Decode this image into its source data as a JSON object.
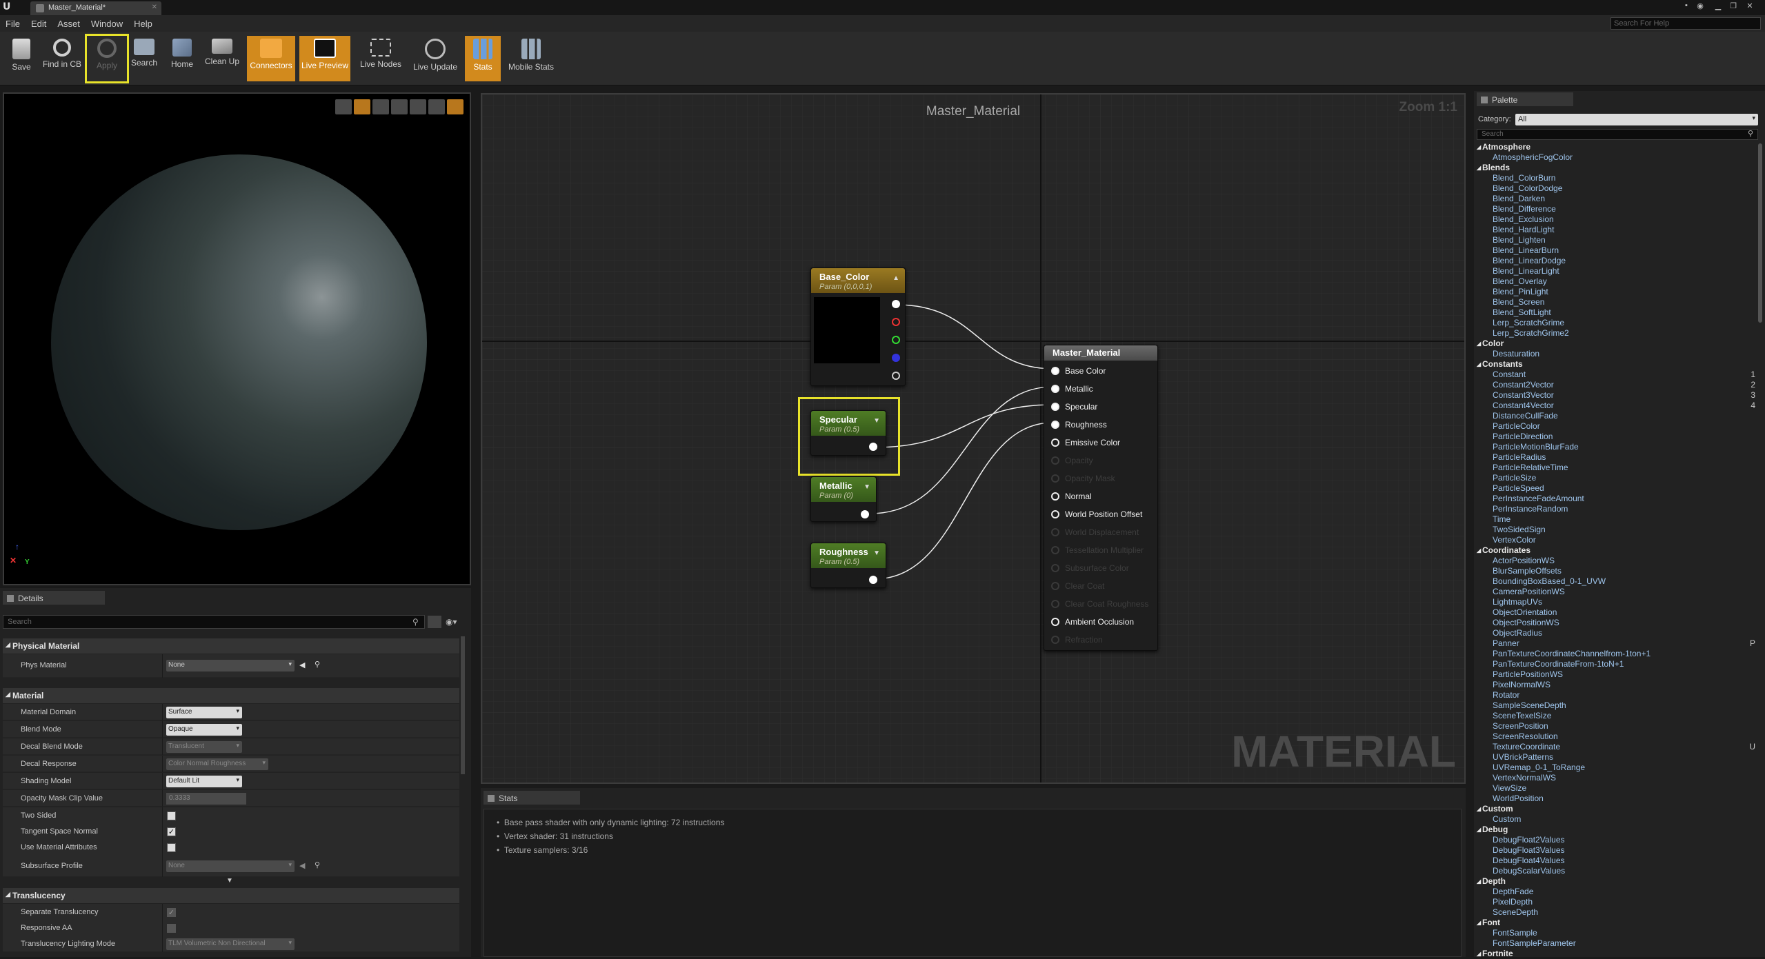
{
  "window": {
    "tab_title": "Master_Material*"
  },
  "menu": [
    "File",
    "Edit",
    "Asset",
    "Window",
    "Help"
  ],
  "help_search_placeholder": "Search For Help",
  "toolbar": [
    {
      "label": "Save",
      "state": "normal"
    },
    {
      "label": "Find in CB",
      "state": "normal"
    },
    {
      "label": "Apply",
      "state": "disabled-highlighted"
    },
    {
      "label": "Search",
      "state": "normal"
    },
    {
      "label": "Home",
      "state": "normal"
    },
    {
      "label": "Clean Up",
      "state": "normal"
    },
    {
      "label": "Connectors",
      "state": "active"
    },
    {
      "label": "Live Preview",
      "state": "active"
    },
    {
      "label": "Live Nodes",
      "state": "normal"
    },
    {
      "label": "Live Update",
      "state": "normal"
    },
    {
      "label": "Stats",
      "state": "active"
    },
    {
      "label": "Mobile Stats",
      "state": "normal"
    }
  ],
  "details": {
    "tab": "Details",
    "search_placeholder": "Search",
    "sections": {
      "physical": "Physical Material",
      "material": "Material",
      "translucency": "Translucency"
    },
    "rows": {
      "phys_material": {
        "label": "Phys Material",
        "value": "None"
      },
      "material_domain": {
        "label": "Material Domain",
        "value": "Surface"
      },
      "blend_mode": {
        "label": "Blend Mode",
        "value": "Opaque"
      },
      "decal_blend_mode": {
        "label": "Decal Blend Mode",
        "value": "Translucent"
      },
      "decal_response": {
        "label": "Decal Response",
        "value": "Color Normal Roughness"
      },
      "shading_model": {
        "label": "Shading Model",
        "value": "Default Lit"
      },
      "opacity_mask_clip": {
        "label": "Opacity Mask Clip Value",
        "value": "0.3333"
      },
      "two_sided": {
        "label": "Two Sided",
        "checked": false
      },
      "tangent_space_normal": {
        "label": "Tangent Space Normal",
        "checked": true
      },
      "use_material_attributes": {
        "label": "Use Material Attributes",
        "checked": false
      },
      "subsurface_profile": {
        "label": "Subsurface Profile",
        "value": "None"
      },
      "separate_translucency": {
        "label": "Separate Translucency",
        "checked": true
      },
      "responsive_aa": {
        "label": "Responsive AA",
        "checked": false
      },
      "translucency_lighting_mode": {
        "label": "Translucency Lighting Mode",
        "value": "TLM Volumetric Non Directional"
      }
    }
  },
  "graph": {
    "title": "Master_Material",
    "zoom": "Zoom 1:1",
    "watermark": "MATERIAL",
    "nodes": {
      "base_color": {
        "title": "Base_Color",
        "subtitle": "Param (0,0,0,1)"
      },
      "specular": {
        "title": "Specular",
        "subtitle": "Param (0.5)"
      },
      "metallic": {
        "title": "Metallic",
        "subtitle": "Param (0)"
      },
      "roughness": {
        "title": "Roughness",
        "subtitle": "Param (0.5)"
      },
      "master": {
        "title": "Master_Material",
        "inputs": [
          {
            "label": "Base Color",
            "enabled": true,
            "connected": true
          },
          {
            "label": "Metallic",
            "enabled": true,
            "connected": true
          },
          {
            "label": "Specular",
            "enabled": true,
            "connected": true
          },
          {
            "label": "Roughness",
            "enabled": true,
            "connected": true
          },
          {
            "label": "Emissive Color",
            "enabled": true,
            "connected": false
          },
          {
            "label": "Opacity",
            "enabled": false,
            "connected": false
          },
          {
            "label": "Opacity Mask",
            "enabled": false,
            "connected": false
          },
          {
            "label": "Normal",
            "enabled": true,
            "connected": false
          },
          {
            "label": "World Position Offset",
            "enabled": true,
            "connected": false
          },
          {
            "label": "World Displacement",
            "enabled": false,
            "connected": false
          },
          {
            "label": "Tessellation Multiplier",
            "enabled": false,
            "connected": false
          },
          {
            "label": "Subsurface Color",
            "enabled": false,
            "connected": false
          },
          {
            "label": "Clear Coat",
            "enabled": false,
            "connected": false
          },
          {
            "label": "Clear Coat Roughness",
            "enabled": false,
            "connected": false
          },
          {
            "label": "Ambient Occlusion",
            "enabled": true,
            "connected": false
          },
          {
            "label": "Refraction",
            "enabled": false,
            "connected": false
          }
        ]
      }
    }
  },
  "stats": {
    "tab": "Stats",
    "lines": [
      "Base pass shader with only dynamic lighting: 72 instructions",
      "Vertex shader: 31 instructions",
      "Texture samplers: 3/16"
    ]
  },
  "palette": {
    "tab": "Palette",
    "category_label": "Category:",
    "category_value": "All",
    "search_placeholder": "Search",
    "entries": [
      {
        "type": "cat",
        "text": "Atmosphere"
      },
      {
        "type": "item",
        "text": "AtmosphericFogColor"
      },
      {
        "type": "cat",
        "text": "Blends"
      },
      {
        "type": "item",
        "text": "Blend_ColorBurn"
      },
      {
        "type": "item",
        "text": "Blend_ColorDodge"
      },
      {
        "type": "item",
        "text": "Blend_Darken"
      },
      {
        "type": "item",
        "text": "Blend_Difference"
      },
      {
        "type": "item",
        "text": "Blend_Exclusion"
      },
      {
        "type": "item",
        "text": "Blend_HardLight"
      },
      {
        "type": "item",
        "text": "Blend_Lighten"
      },
      {
        "type": "item",
        "text": "Blend_LinearBurn"
      },
      {
        "type": "item",
        "text": "Blend_LinearDodge"
      },
      {
        "type": "item",
        "text": "Blend_LinearLight"
      },
      {
        "type": "item",
        "text": "Blend_Overlay"
      },
      {
        "type": "item",
        "text": "Blend_PinLight"
      },
      {
        "type": "item",
        "text": "Blend_Screen"
      },
      {
        "type": "item",
        "text": "Blend_SoftLight"
      },
      {
        "type": "item",
        "text": "Lerp_ScratchGrime"
      },
      {
        "type": "item",
        "text": "Lerp_ScratchGrime2"
      },
      {
        "type": "cat",
        "text": "Color"
      },
      {
        "type": "item",
        "text": "Desaturation"
      },
      {
        "type": "cat",
        "text": "Constants"
      },
      {
        "type": "item",
        "text": "Constant",
        "hotkey": "1"
      },
      {
        "type": "item",
        "text": "Constant2Vector",
        "hotkey": "2"
      },
      {
        "type": "item",
        "text": "Constant3Vector",
        "hotkey": "3"
      },
      {
        "type": "item",
        "text": "Constant4Vector",
        "hotkey": "4"
      },
      {
        "type": "item",
        "text": "DistanceCullFade"
      },
      {
        "type": "item",
        "text": "ParticleColor"
      },
      {
        "type": "item",
        "text": "ParticleDirection"
      },
      {
        "type": "item",
        "text": "ParticleMotionBlurFade"
      },
      {
        "type": "item",
        "text": "ParticleRadius"
      },
      {
        "type": "item",
        "text": "ParticleRelativeTime"
      },
      {
        "type": "item",
        "text": "ParticleSize"
      },
      {
        "type": "item",
        "text": "ParticleSpeed"
      },
      {
        "type": "item",
        "text": "PerInstanceFadeAmount"
      },
      {
        "type": "item",
        "text": "PerInstanceRandom"
      },
      {
        "type": "item",
        "text": "Time"
      },
      {
        "type": "item",
        "text": "TwoSidedSign"
      },
      {
        "type": "item",
        "text": "VertexColor"
      },
      {
        "type": "cat",
        "text": "Coordinates"
      },
      {
        "type": "item",
        "text": "ActorPositionWS"
      },
      {
        "type": "item",
        "text": "BlurSampleOffsets"
      },
      {
        "type": "item",
        "text": "BoundingBoxBased_0-1_UVW"
      },
      {
        "type": "item",
        "text": "CameraPositionWS"
      },
      {
        "type": "item",
        "text": "LightmapUVs"
      },
      {
        "type": "item",
        "text": "ObjectOrientation"
      },
      {
        "type": "item",
        "text": "ObjectPositionWS"
      },
      {
        "type": "item",
        "text": "ObjectRadius"
      },
      {
        "type": "item",
        "text": "Panner",
        "hotkey": "P"
      },
      {
        "type": "item",
        "text": "PanTextureCoordinateChannelfrom-1ton+1"
      },
      {
        "type": "item",
        "text": "PanTextureCoordinateFrom-1toN+1"
      },
      {
        "type": "item",
        "text": "ParticlePositionWS"
      },
      {
        "type": "item",
        "text": "PixelNormalWS"
      },
      {
        "type": "item",
        "text": "Rotator"
      },
      {
        "type": "item",
        "text": "SampleSceneDepth"
      },
      {
        "type": "item",
        "text": "SceneTexelSize"
      },
      {
        "type": "item",
        "text": "ScreenPosition"
      },
      {
        "type": "item",
        "text": "ScreenResolution"
      },
      {
        "type": "item",
        "text": "TextureCoordinate",
        "hotkey": "U"
      },
      {
        "type": "item",
        "text": "UVBrickPatterns"
      },
      {
        "type": "item",
        "text": "UVRemap_0-1_ToRange"
      },
      {
        "type": "item",
        "text": "VertexNormalWS"
      },
      {
        "type": "item",
        "text": "ViewSize"
      },
      {
        "type": "item",
        "text": "WorldPosition"
      },
      {
        "type": "cat",
        "text": "Custom"
      },
      {
        "type": "item",
        "text": "Custom"
      },
      {
        "type": "cat",
        "text": "Debug"
      },
      {
        "type": "item",
        "text": "DebugFloat2Values"
      },
      {
        "type": "item",
        "text": "DebugFloat3Values"
      },
      {
        "type": "item",
        "text": "DebugFloat4Values"
      },
      {
        "type": "item",
        "text": "DebugScalarValues"
      },
      {
        "type": "cat",
        "text": "Depth"
      },
      {
        "type": "item",
        "text": "DepthFade"
      },
      {
        "type": "item",
        "text": "PixelDepth"
      },
      {
        "type": "item",
        "text": "SceneDepth"
      },
      {
        "type": "cat",
        "text": "Font"
      },
      {
        "type": "item",
        "text": "FontSample"
      },
      {
        "type": "item",
        "text": "FontSampleParameter"
      },
      {
        "type": "cat",
        "text": "Fortnite"
      }
    ]
  },
  "colors": {
    "accent_active": "#d28a1d",
    "highlight_outline": "#e8e32a",
    "vector_param_header": "#8a6a1a",
    "scalar_param_header": "#3f6a1e",
    "palette_item": "#9fc5ec"
  }
}
